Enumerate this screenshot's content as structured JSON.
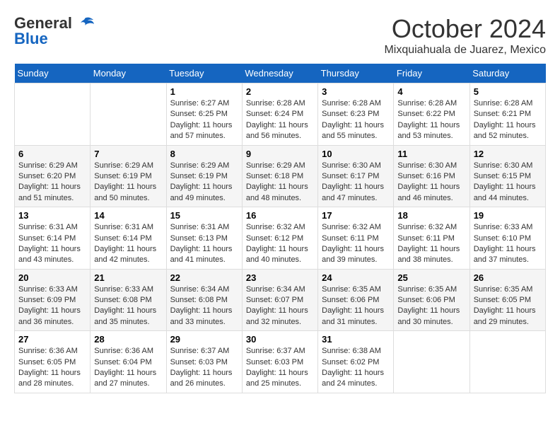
{
  "header": {
    "logo_general": "General",
    "logo_blue": "Blue",
    "month": "October 2024",
    "location": "Mixquiahuala de Juarez, Mexico"
  },
  "weekdays": [
    "Sunday",
    "Monday",
    "Tuesday",
    "Wednesday",
    "Thursday",
    "Friday",
    "Saturday"
  ],
  "weeks": [
    [
      {
        "day": "",
        "sunrise": "",
        "sunset": "",
        "daylight": ""
      },
      {
        "day": "",
        "sunrise": "",
        "sunset": "",
        "daylight": ""
      },
      {
        "day": "1",
        "sunrise": "Sunrise: 6:27 AM",
        "sunset": "Sunset: 6:25 PM",
        "daylight": "Daylight: 11 hours and 57 minutes."
      },
      {
        "day": "2",
        "sunrise": "Sunrise: 6:28 AM",
        "sunset": "Sunset: 6:24 PM",
        "daylight": "Daylight: 11 hours and 56 minutes."
      },
      {
        "day": "3",
        "sunrise": "Sunrise: 6:28 AM",
        "sunset": "Sunset: 6:23 PM",
        "daylight": "Daylight: 11 hours and 55 minutes."
      },
      {
        "day": "4",
        "sunrise": "Sunrise: 6:28 AM",
        "sunset": "Sunset: 6:22 PM",
        "daylight": "Daylight: 11 hours and 53 minutes."
      },
      {
        "day": "5",
        "sunrise": "Sunrise: 6:28 AM",
        "sunset": "Sunset: 6:21 PM",
        "daylight": "Daylight: 11 hours and 52 minutes."
      }
    ],
    [
      {
        "day": "6",
        "sunrise": "Sunrise: 6:29 AM",
        "sunset": "Sunset: 6:20 PM",
        "daylight": "Daylight: 11 hours and 51 minutes."
      },
      {
        "day": "7",
        "sunrise": "Sunrise: 6:29 AM",
        "sunset": "Sunset: 6:19 PM",
        "daylight": "Daylight: 11 hours and 50 minutes."
      },
      {
        "day": "8",
        "sunrise": "Sunrise: 6:29 AM",
        "sunset": "Sunset: 6:19 PM",
        "daylight": "Daylight: 11 hours and 49 minutes."
      },
      {
        "day": "9",
        "sunrise": "Sunrise: 6:29 AM",
        "sunset": "Sunset: 6:18 PM",
        "daylight": "Daylight: 11 hours and 48 minutes."
      },
      {
        "day": "10",
        "sunrise": "Sunrise: 6:30 AM",
        "sunset": "Sunset: 6:17 PM",
        "daylight": "Daylight: 11 hours and 47 minutes."
      },
      {
        "day": "11",
        "sunrise": "Sunrise: 6:30 AM",
        "sunset": "Sunset: 6:16 PM",
        "daylight": "Daylight: 11 hours and 46 minutes."
      },
      {
        "day": "12",
        "sunrise": "Sunrise: 6:30 AM",
        "sunset": "Sunset: 6:15 PM",
        "daylight": "Daylight: 11 hours and 44 minutes."
      }
    ],
    [
      {
        "day": "13",
        "sunrise": "Sunrise: 6:31 AM",
        "sunset": "Sunset: 6:14 PM",
        "daylight": "Daylight: 11 hours and 43 minutes."
      },
      {
        "day": "14",
        "sunrise": "Sunrise: 6:31 AM",
        "sunset": "Sunset: 6:14 PM",
        "daylight": "Daylight: 11 hours and 42 minutes."
      },
      {
        "day": "15",
        "sunrise": "Sunrise: 6:31 AM",
        "sunset": "Sunset: 6:13 PM",
        "daylight": "Daylight: 11 hours and 41 minutes."
      },
      {
        "day": "16",
        "sunrise": "Sunrise: 6:32 AM",
        "sunset": "Sunset: 6:12 PM",
        "daylight": "Daylight: 11 hours and 40 minutes."
      },
      {
        "day": "17",
        "sunrise": "Sunrise: 6:32 AM",
        "sunset": "Sunset: 6:11 PM",
        "daylight": "Daylight: 11 hours and 39 minutes."
      },
      {
        "day": "18",
        "sunrise": "Sunrise: 6:32 AM",
        "sunset": "Sunset: 6:11 PM",
        "daylight": "Daylight: 11 hours and 38 minutes."
      },
      {
        "day": "19",
        "sunrise": "Sunrise: 6:33 AM",
        "sunset": "Sunset: 6:10 PM",
        "daylight": "Daylight: 11 hours and 37 minutes."
      }
    ],
    [
      {
        "day": "20",
        "sunrise": "Sunrise: 6:33 AM",
        "sunset": "Sunset: 6:09 PM",
        "daylight": "Daylight: 11 hours and 36 minutes."
      },
      {
        "day": "21",
        "sunrise": "Sunrise: 6:33 AM",
        "sunset": "Sunset: 6:08 PM",
        "daylight": "Daylight: 11 hours and 35 minutes."
      },
      {
        "day": "22",
        "sunrise": "Sunrise: 6:34 AM",
        "sunset": "Sunset: 6:08 PM",
        "daylight": "Daylight: 11 hours and 33 minutes."
      },
      {
        "day": "23",
        "sunrise": "Sunrise: 6:34 AM",
        "sunset": "Sunset: 6:07 PM",
        "daylight": "Daylight: 11 hours and 32 minutes."
      },
      {
        "day": "24",
        "sunrise": "Sunrise: 6:35 AM",
        "sunset": "Sunset: 6:06 PM",
        "daylight": "Daylight: 11 hours and 31 minutes."
      },
      {
        "day": "25",
        "sunrise": "Sunrise: 6:35 AM",
        "sunset": "Sunset: 6:06 PM",
        "daylight": "Daylight: 11 hours and 30 minutes."
      },
      {
        "day": "26",
        "sunrise": "Sunrise: 6:35 AM",
        "sunset": "Sunset: 6:05 PM",
        "daylight": "Daylight: 11 hours and 29 minutes."
      }
    ],
    [
      {
        "day": "27",
        "sunrise": "Sunrise: 6:36 AM",
        "sunset": "Sunset: 6:05 PM",
        "daylight": "Daylight: 11 hours and 28 minutes."
      },
      {
        "day": "28",
        "sunrise": "Sunrise: 6:36 AM",
        "sunset": "Sunset: 6:04 PM",
        "daylight": "Daylight: 11 hours and 27 minutes."
      },
      {
        "day": "29",
        "sunrise": "Sunrise: 6:37 AM",
        "sunset": "Sunset: 6:03 PM",
        "daylight": "Daylight: 11 hours and 26 minutes."
      },
      {
        "day": "30",
        "sunrise": "Sunrise: 6:37 AM",
        "sunset": "Sunset: 6:03 PM",
        "daylight": "Daylight: 11 hours and 25 minutes."
      },
      {
        "day": "31",
        "sunrise": "Sunrise: 6:38 AM",
        "sunset": "Sunset: 6:02 PM",
        "daylight": "Daylight: 11 hours and 24 minutes."
      },
      {
        "day": "",
        "sunrise": "",
        "sunset": "",
        "daylight": ""
      },
      {
        "day": "",
        "sunrise": "",
        "sunset": "",
        "daylight": ""
      }
    ]
  ]
}
